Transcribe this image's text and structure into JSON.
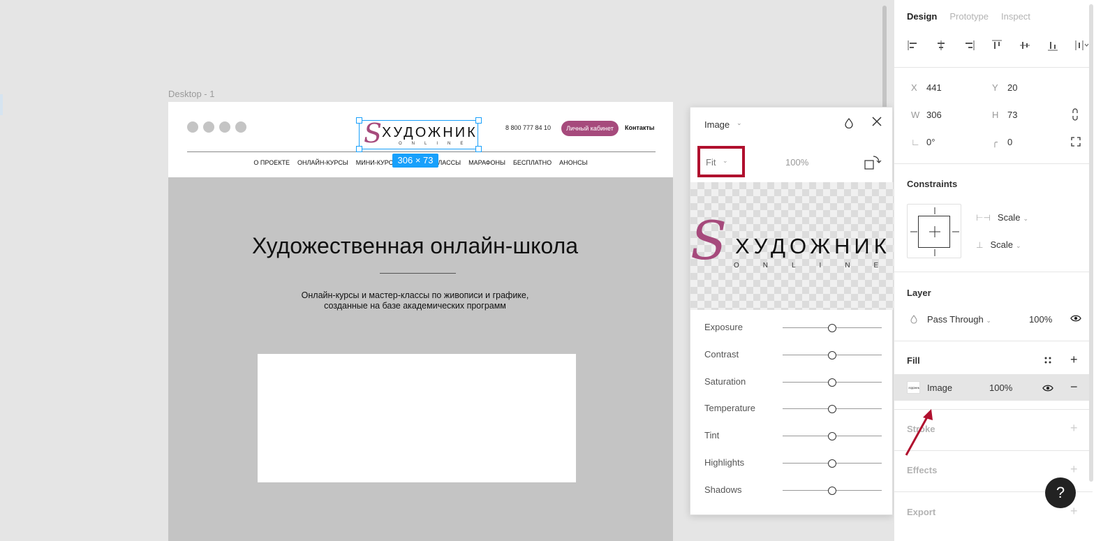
{
  "canvas": {
    "frame_label": "Desktop - 1",
    "size_badge": "306 × 73"
  },
  "site": {
    "phone": "8 800 777 84 10",
    "cabinet": "Личный кабинет",
    "contacts": "Контакты",
    "logo_word": "ХУДОЖНИК",
    "logo_sub": "ONLINE",
    "logo_mark": "S",
    "nav": [
      "О ПРОЕКТЕ",
      "ОНЛАЙН-КУРСЫ",
      "МИНИ-КУРСЫ",
      "МАСТЕР-КЛАССЫ",
      "МАРАФОНЫ",
      "БЕСПЛАТНО",
      "АНОНСЫ"
    ],
    "hero_title": "Художественная онлайн-школа",
    "hero_sub_1": "Онлайн-курсы и мастер-классы по живописи и графике,",
    "hero_sub_2": "созданные на базе академических программ"
  },
  "image_popover": {
    "title": "Image",
    "fit_label": "Fit",
    "percent": "100%",
    "sliders": [
      {
        "label": "Exposure",
        "value": 0.5
      },
      {
        "label": "Contrast",
        "value": 0.5
      },
      {
        "label": "Saturation",
        "value": 0.5
      },
      {
        "label": "Temperature",
        "value": 0.5
      },
      {
        "label": "Tint",
        "value": 0.5
      },
      {
        "label": "Highlights",
        "value": 0.5
      },
      {
        "label": "Shadows",
        "value": 0.5
      }
    ]
  },
  "panel": {
    "tabs": {
      "design": "Design",
      "prototype": "Prototype",
      "inspect": "Inspect"
    },
    "x_label": "X",
    "x_value": "441",
    "y_label": "Y",
    "y_value": "20",
    "w_label": "W",
    "w_value": "306",
    "h_label": "H",
    "h_value": "73",
    "rotation": "0°",
    "radius": "0",
    "constraints_title": "Constraints",
    "constraint_h": "Scale",
    "constraint_v": "Scale",
    "layer_title": "Layer",
    "blend_mode": "Pass Through",
    "layer_opacity": "100%",
    "fill_title": "Fill",
    "fill_name": "Image",
    "fill_opacity": "100%",
    "stroke_title": "Stroke",
    "effects_title": "Effects",
    "export_title": "Export",
    "help": "?"
  },
  "colors": {
    "accent": "#18a0fb",
    "brand": "#a64a7c",
    "highlight_box": "#b0102e"
  }
}
